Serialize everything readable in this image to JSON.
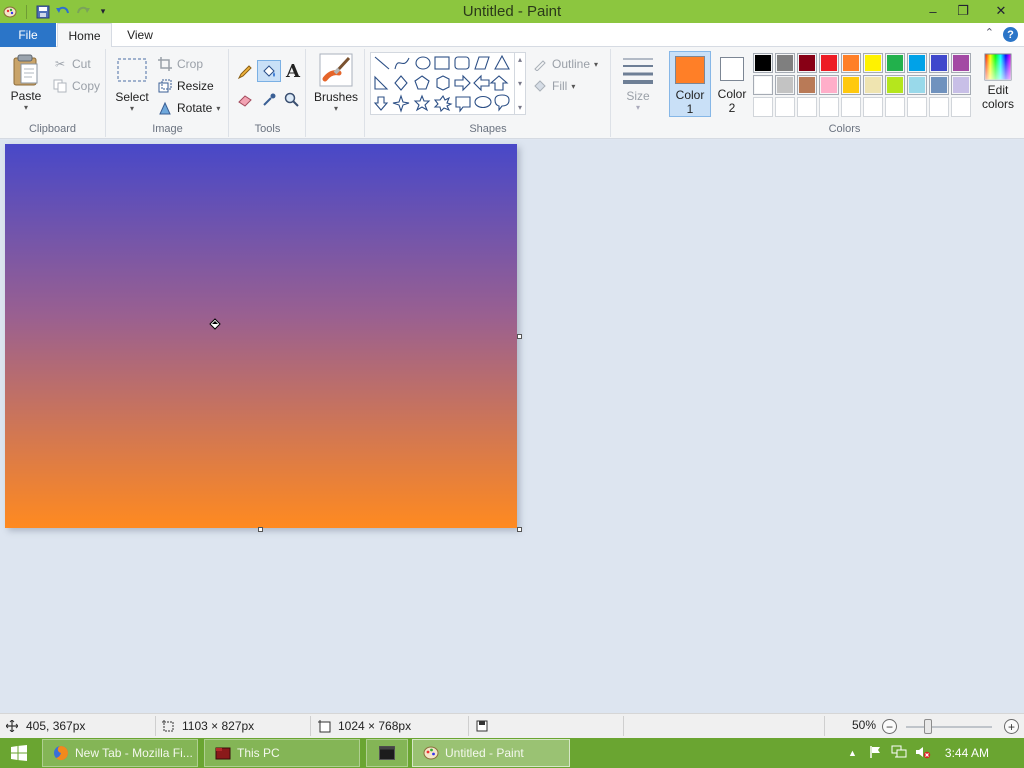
{
  "window": {
    "title": "Untitled - Paint",
    "minimize": "–",
    "restore": "❐",
    "close": "✕"
  },
  "tabs": {
    "file": "File",
    "home": "Home",
    "view": "View",
    "help": "?"
  },
  "ribbon": {
    "clipboard": {
      "group_label": "Clipboard",
      "paste": "Paste",
      "cut": "Cut",
      "copy": "Copy"
    },
    "image": {
      "group_label": "Image",
      "select": "Select",
      "crop": "Crop",
      "resize": "Resize",
      "rotate": "Rotate"
    },
    "tools": {
      "group_label": "Tools",
      "text_tool": "A"
    },
    "brushes": {
      "label": "Brushes"
    },
    "shapes": {
      "group_label": "Shapes",
      "outline": "Outline",
      "fill": "Fill"
    },
    "size": {
      "label": "Size"
    },
    "colors": {
      "group_label": "Colors",
      "color1_line1": "Color",
      "color1_line2": "1",
      "color2_line1": "Color",
      "color2_line2": "2",
      "edit_line1": "Edit",
      "edit_line2": "colors",
      "color1_value": "#ff7f27",
      "color2_value": "#ffffff",
      "palette_row1": [
        "#000000",
        "#7f7f7f",
        "#880015",
        "#ed1c24",
        "#ff7f27",
        "#fff200",
        "#22b14c",
        "#00a2e8",
        "#3f48cc",
        "#a349a4"
      ],
      "palette_row2": [
        "#ffffff",
        "#c3c3c3",
        "#b97a57",
        "#ffaec9",
        "#ffc90e",
        "#efe4b0",
        "#b5e61d",
        "#99d9ea",
        "#7092be",
        "#c8bfe7"
      ]
    }
  },
  "canvas": {
    "gradient_top": "#4848c8",
    "gradient_bottom": "#ff8a20"
  },
  "statusbar": {
    "cursor_pos": "405, 367px",
    "selection_size": "1103 × 827px",
    "image_size": "1024 × 768px",
    "zoom": "50%",
    "zoom_slider_fraction": 0.25
  },
  "taskbar": {
    "items": [
      {
        "label": "New Tab - Mozilla Fi...",
        "icon": "firefox-icon"
      },
      {
        "label": "This PC",
        "icon": "folder-icon"
      },
      {
        "label": "",
        "icon": "terminal-icon"
      },
      {
        "label": "Untitled - Paint",
        "icon": "paint-icon"
      }
    ],
    "clock": "3:44 AM"
  }
}
